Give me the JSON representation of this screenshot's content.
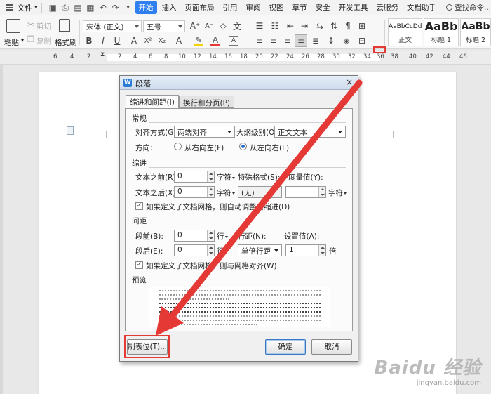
{
  "menubar": {
    "file_label": "文件",
    "menus": [
      "开始",
      "插入",
      "页面布局",
      "引用",
      "审阅",
      "视图",
      "章节",
      "安全",
      "开发工具",
      "云服务",
      "文档助手"
    ],
    "active_menu": "开始",
    "search_label": "查找命令..."
  },
  "ribbon": {
    "paste_label": "粘贴",
    "cut_label": "剪切",
    "copy_label": "复制",
    "format_painter_label": "格式刷",
    "font_name": "宋体 (正文)",
    "font_size": "五号",
    "bold": "B",
    "italic": "I",
    "underline": "U",
    "styles": [
      {
        "preview": "AaBbCcDd",
        "label": "正文"
      },
      {
        "preview": "AaBb",
        "label": "标题 1"
      },
      {
        "preview": "AaBb",
        "label": "标题 2"
      }
    ]
  },
  "ruler": {
    "numbers": [
      "6",
      "4",
      "2",
      "2",
      "4",
      "6",
      "8",
      "10",
      "12",
      "14",
      "16",
      "18",
      "20",
      "22",
      "24",
      "26",
      "28",
      "30",
      "32",
      "34",
      "36",
      "38",
      "40",
      "42",
      "44",
      "46"
    ]
  },
  "dialog": {
    "title": "段落",
    "close_symbol": "×",
    "tabs": [
      "缩进和间距(I)",
      "换行和分页(P)"
    ],
    "selected_tab": 0,
    "general": {
      "section": "常规",
      "alignment_label": "对齐方式(G):",
      "alignment_value": "两端对齐",
      "outline_label": "大纲级别(O):",
      "outline_value": "正文文本",
      "direction_label": "方向:",
      "rtl_label": "从右向左(F)",
      "ltr_label": "从左向右(L)",
      "ltr_selected": true
    },
    "indent": {
      "section": "缩进",
      "before_label": "文本之前(R):",
      "before_value": "0",
      "before_unit": "字符",
      "after_label": "文本之后(X):",
      "after_value": "0",
      "after_unit": "字符",
      "special_label": "特殊格式(S):",
      "special_value": "(无)",
      "measure_label": "度量值(Y):",
      "measure_value": "",
      "measure_unit": "字符",
      "grid_check_label": "如果定义了文档网格，则自动调整右缩进(D)",
      "grid_checked": true
    },
    "spacing": {
      "section": "间距",
      "before_label": "段前(B):",
      "before_value": "0",
      "before_unit": "行",
      "after_label": "段后(E):",
      "after_value": "0",
      "after_unit": "行",
      "line_label": "行距(N):",
      "line_value": "单倍行距",
      "setting_label": "设置值(A):",
      "setting_value": "1",
      "setting_unit": "倍",
      "grid_check_label": "如果定义了文档网格，则与网格对齐(W)",
      "grid_checked": true
    },
    "preview": {
      "section": "预览"
    },
    "buttons": {
      "tabstops": "制表位(T)...",
      "ok": "确定",
      "cancel": "取消"
    }
  },
  "watermark": {
    "logo": "Baidu 经验",
    "url": "jingyan.baidu.com"
  },
  "colors": {
    "accent": "#2f7ff0",
    "highlight": "#e53935"
  }
}
